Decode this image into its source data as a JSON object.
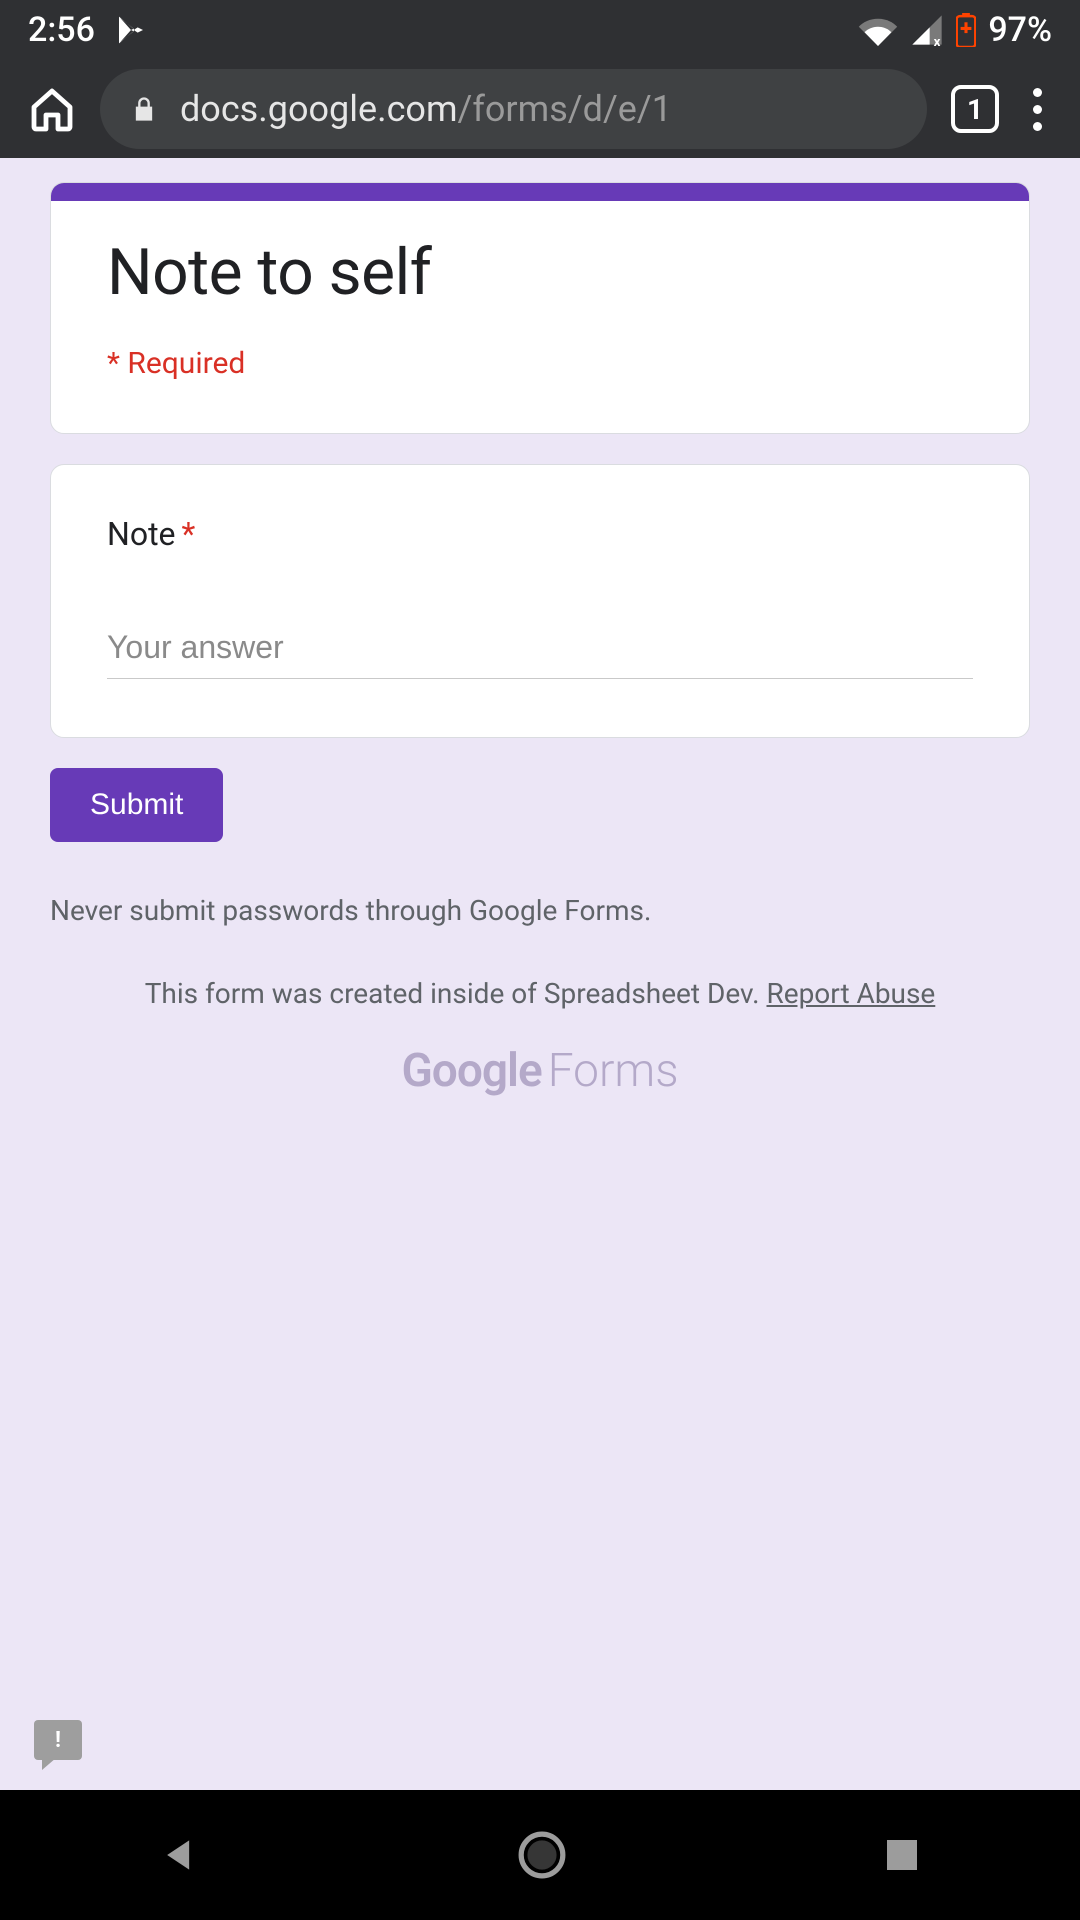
{
  "status": {
    "time": "2:56",
    "battery_pct": "97%"
  },
  "browser": {
    "url_main": "docs.google.com",
    "url_rest": "/forms/d/e/1",
    "tab_count": "1"
  },
  "form": {
    "title": "Note to self",
    "required_note": "* Required",
    "question_label": "Note",
    "answer_placeholder": "Your answer",
    "submit_label": "Submit",
    "password_disclaimer": "Never submit passwords through Google Forms.",
    "origin_text": "This form was created inside of Spreadsheet Dev. ",
    "report_abuse": "Report Abuse",
    "brand_google": "Google",
    "brand_forms": "Forms"
  },
  "colors": {
    "accent": "#673ab7",
    "required": "#d93025",
    "page_bg": "#ece6f6"
  }
}
